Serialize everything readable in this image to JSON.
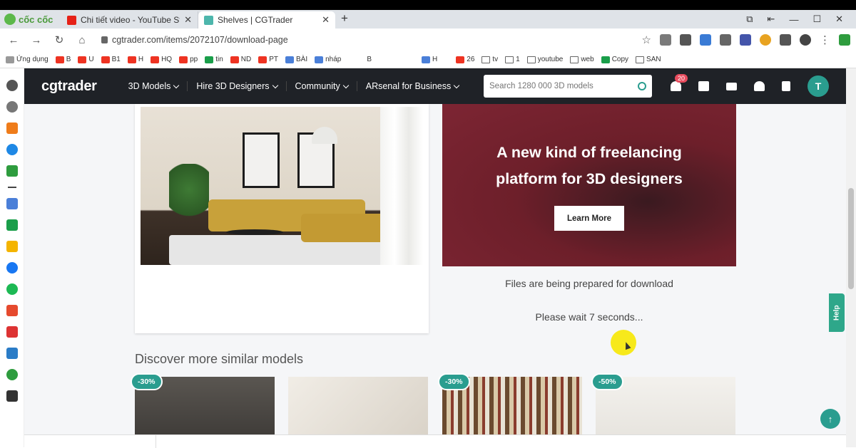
{
  "browser": {
    "brand": "cốc cốc",
    "tabs": [
      {
        "title": "Chi tiết video - YouTube Studio",
        "favicon_color": "#e62117",
        "active": false
      },
      {
        "title": "Shelves | CGTrader",
        "favicon_color": "#4db6ac",
        "active": true
      }
    ],
    "url": "cgtrader.com/items/2072107/download-page",
    "bookmarks": [
      "Ứng dụng",
      "B",
      "U",
      "B1",
      "H",
      "HQ",
      "pp",
      "tin",
      "ND",
      "PT",
      "BÀI",
      "nháp",
      "B",
      "H",
      "26",
      "tv",
      "1",
      "youtube",
      "web",
      "Copy",
      "SAN"
    ]
  },
  "site": {
    "logo": "cgtrader",
    "menu": [
      "3D Models",
      "Hire 3D Designers",
      "Community",
      "ARsenal for Business"
    ],
    "search_placeholder": "Search 1280 000 3D models",
    "cart_badge": "20",
    "avatar_letter": "T"
  },
  "banner": {
    "heading_line1": "A new kind of freelancing",
    "heading_line2": "platform for 3D designers",
    "button": "Learn More"
  },
  "status": {
    "preparing": "Files are being prepared for download",
    "wait": "Please wait 7 seconds..."
  },
  "similar": {
    "heading": "Discover more similar models",
    "items": [
      {
        "badge": "-30%"
      },
      {
        "badge": ""
      },
      {
        "badge": "-30%"
      },
      {
        "badge": "-50%"
      }
    ]
  },
  "help_label": "Help",
  "colors": {
    "accent": "#2a9d8f",
    "nav_bg": "#1f2227",
    "banner": "#7d2533"
  }
}
